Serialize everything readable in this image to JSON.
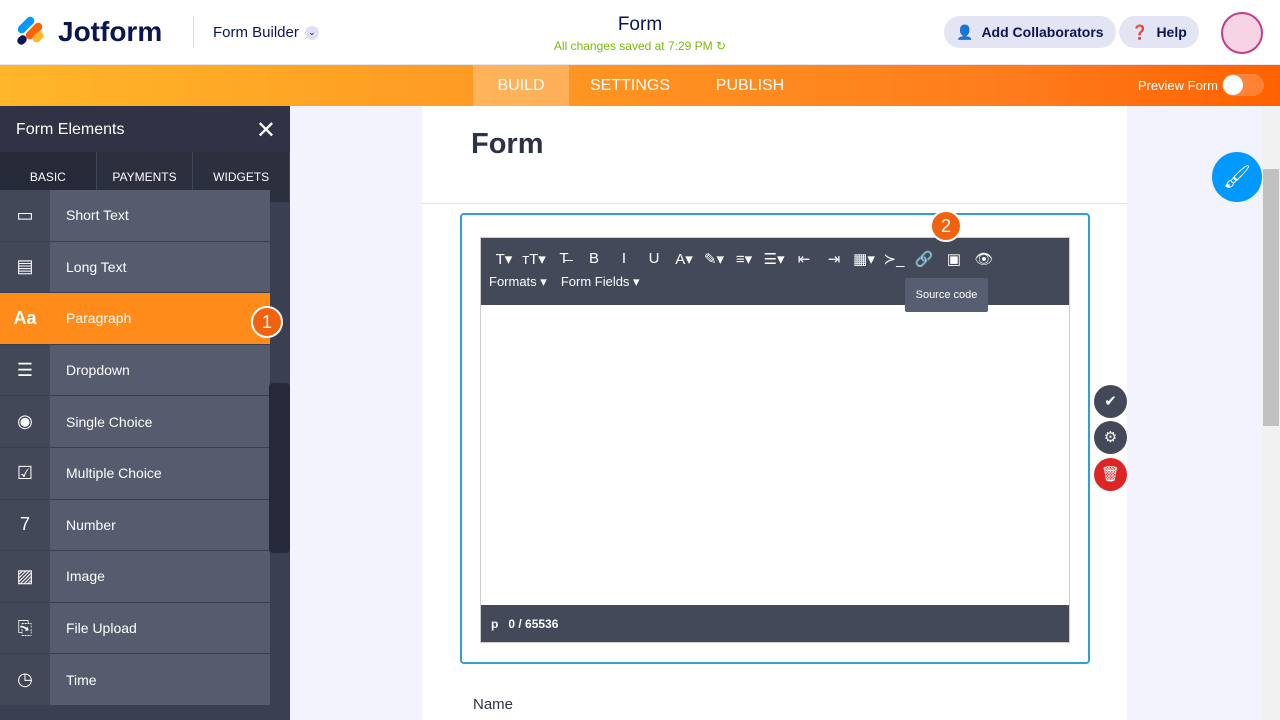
{
  "header": {
    "brand": "Jotform",
    "builder_label": "Form Builder",
    "form_title": "Form",
    "saved_status": "All changes saved at 7:29 PM",
    "add_collaborators": "Add Collaborators",
    "help": "Help"
  },
  "nav": {
    "tabs": [
      "BUILD",
      "SETTINGS",
      "PUBLISH"
    ],
    "active": "BUILD",
    "preview_label": "Preview Form",
    "preview_on": false
  },
  "sidebar": {
    "title": "Form Elements",
    "tabs": [
      "BASIC",
      "PAYMENTS",
      "WIDGETS"
    ],
    "items": [
      {
        "label": "Short Text",
        "icon": "short-text-icon",
        "glyph": "▭"
      },
      {
        "label": "Long Text",
        "icon": "long-text-icon",
        "glyph": "▤"
      },
      {
        "label": "Paragraph",
        "icon": "paragraph-icon",
        "glyph": "Aa"
      },
      {
        "label": "Dropdown",
        "icon": "dropdown-icon",
        "glyph": "☰"
      },
      {
        "label": "Single Choice",
        "icon": "radio-icon",
        "glyph": "◉"
      },
      {
        "label": "Multiple Choice",
        "icon": "checkbox-icon",
        "glyph": "☑"
      },
      {
        "label": "Number",
        "icon": "number-icon",
        "glyph": "7"
      },
      {
        "label": "Image",
        "icon": "image-icon",
        "glyph": "▨"
      },
      {
        "label": "File Upload",
        "icon": "file-upload-icon",
        "glyph": "⎘"
      },
      {
        "label": "Time",
        "icon": "clock-icon",
        "glyph": "◷"
      }
    ]
  },
  "steps": {
    "one": "1",
    "two": "2"
  },
  "form": {
    "heading": "Form",
    "field_label": "Name"
  },
  "editor": {
    "toolbar_glyphs": [
      "T▾",
      "ᴛT▾",
      "T̶",
      "B",
      "I",
      "U",
      "A▾",
      "✎▾",
      "≡▾",
      "☰▾",
      "⇤",
      "⇥",
      "▦▾",
      "≻_",
      "🔗",
      "▣",
      "👁"
    ],
    "formats": "Formats ▾",
    "form_fields": "Form Fields ▾",
    "tooltip": "Source code",
    "path": "p",
    "char_count": "0 / 65536"
  }
}
